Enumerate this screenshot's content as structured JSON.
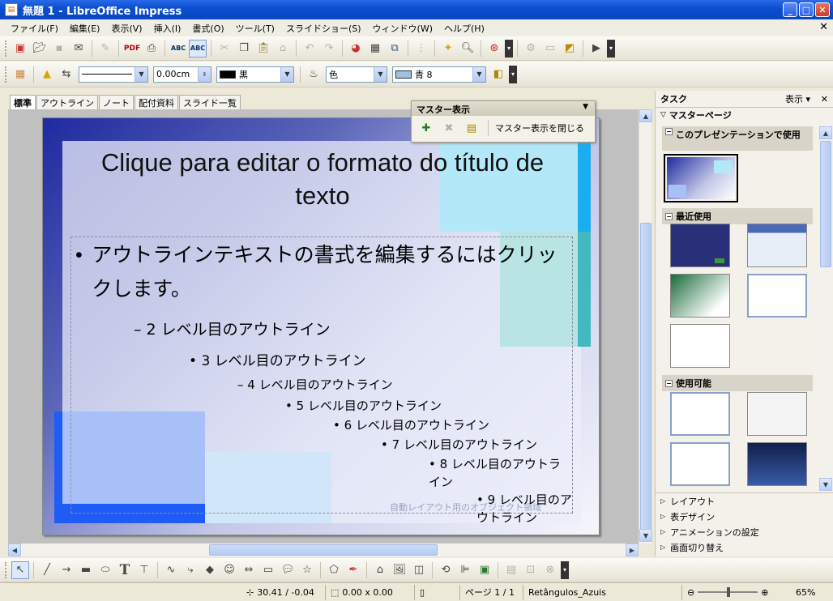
{
  "window": {
    "title": "無題 1 - LibreOffice Impress"
  },
  "menu": {
    "items": [
      "ファイル(F)",
      "編集(E)",
      "表示(V)",
      "挿入(I)",
      "書式(O)",
      "ツール(T)",
      "スライドショー(S)",
      "ウィンドウ(W)",
      "ヘルプ(H)"
    ]
  },
  "formatting": {
    "line_width": "0.00cm",
    "line_color": "黒",
    "area_style": "色",
    "area_color": "青 8"
  },
  "tabs": [
    "標準",
    "アウトライン",
    "ノート",
    "配付資料",
    "スライド一覧"
  ],
  "master_toolbar": {
    "title": "マスター表示",
    "close_label": "マスター表示を閉じる"
  },
  "slide": {
    "title": "Clique para editar o formato do título de texto",
    "outline": [
      "アウトラインテキストの書式を編集するにはクリックします。",
      "2 レベル目のアウトライン",
      "3 レベル目のアウトライン",
      "4 レベル目のアウトライン",
      "5 レベル目のアウトライン",
      "6 レベル目のアウトライン",
      "7 レベル目のアウトライン",
      "8 レベル目のアウトライン",
      "9 レベル目のアウトライン"
    ],
    "autolayout_hint": "自動レイアウト用のオブジェクト領域"
  },
  "taskpane": {
    "title": "タスク",
    "view_label": "表示",
    "master_pages_label": "マスターページ",
    "section_used": "このプレゼンテーションで使用",
    "section_recent": "最近使用",
    "section_available": "使用可能",
    "bottom_links": [
      "レイアウト",
      "表デザイン",
      "アニメーションの設定",
      "画面切り替え"
    ]
  },
  "status": {
    "position": "30.41 / -0.04",
    "size": "0.00 x 0.00",
    "page": "ページ 1 / 1",
    "master": "Retângulos_Azuis",
    "zoom": "65%"
  }
}
